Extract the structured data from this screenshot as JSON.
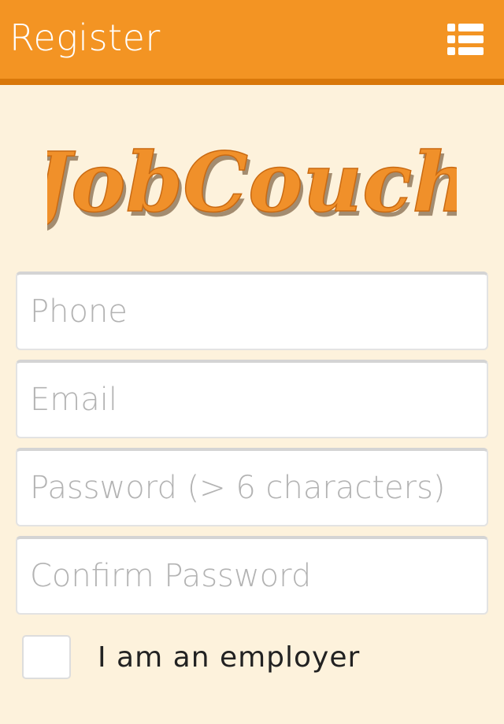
{
  "header": {
    "title": "Register",
    "menu_icon": "list-menu-icon",
    "background_color": "#f39423"
  },
  "logo": {
    "text": "JobCouch",
    "color": "#f0902a"
  },
  "form": {
    "phone_placeholder": "Phone",
    "email_placeholder": "Email",
    "password_placeholder": "Password (> 6 characters)",
    "confirm_placeholder": "Confirm Password",
    "employer_label": "I am an employer",
    "employer_checked": false
  }
}
